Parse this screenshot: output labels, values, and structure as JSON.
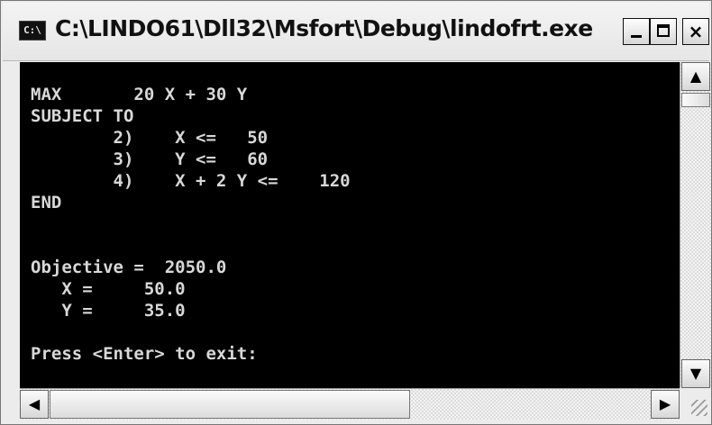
{
  "window": {
    "title": "C:\\LINDO61\\Dll32\\Msfort\\Debug\\lindofrt.exe",
    "icon_text": "C:\\",
    "buttons": {
      "minimize": "minimize-icon",
      "maximize": "maximize-icon",
      "close": "×"
    }
  },
  "console": {
    "background": "#000000",
    "foreground": "#d8d8d8",
    "text": "MAX       20 X + 30 Y\nSUBJECT TO\n        2)    X <=   50\n        3)    Y <=   60\n        4)    X + 2 Y <=    120\nEND\n\n\nObjective =  2050.0\n   X =     50.0\n   Y =     35.0\n\nPress <Enter> to exit:"
  },
  "scrollbars": {
    "up_arrow": "▲",
    "down_arrow": "▼",
    "left_arrow": "◀",
    "right_arrow": "▶"
  }
}
